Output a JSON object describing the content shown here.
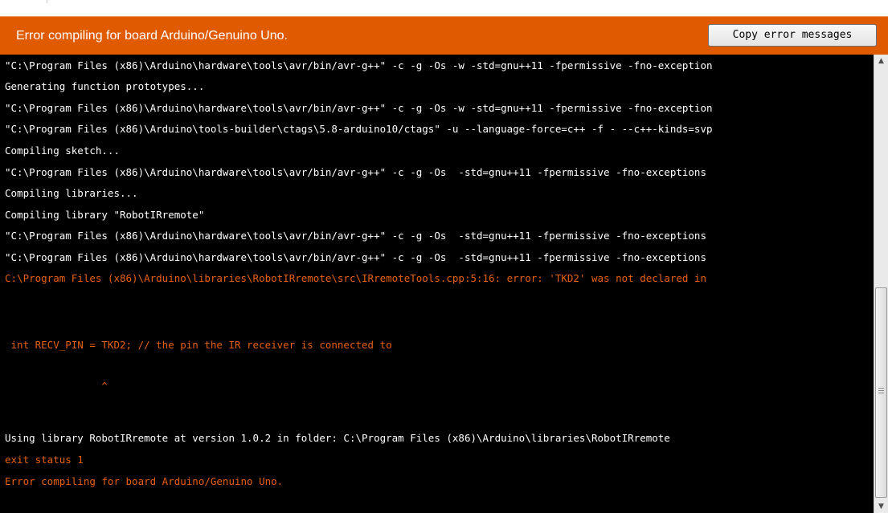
{
  "error_bar": {
    "message": "Error compiling for board Arduino/Genuino Uno.",
    "copy_button_label": "Copy error messages",
    "color": "#e05a00"
  },
  "console": {
    "lines": [
      {
        "text": "\"C:\\Program Files (x86)\\Arduino\\hardware\\tools\\avr/bin/avr-g++\" -c -g -Os -w -std=gnu++11 -fpermissive -fno-exception",
        "kind": "normal"
      },
      {
        "text": "Generating function prototypes...",
        "kind": "normal"
      },
      {
        "text": "\"C:\\Program Files (x86)\\Arduino\\hardware\\tools\\avr/bin/avr-g++\" -c -g -Os -w -std=gnu++11 -fpermissive -fno-exception",
        "kind": "normal"
      },
      {
        "text": "\"C:\\Program Files (x86)\\Arduino\\tools-builder\\ctags\\5.8-arduino10/ctags\" -u --language-force=c++ -f - --c++-kinds=svp",
        "kind": "normal"
      },
      {
        "text": "Compiling sketch...",
        "kind": "normal"
      },
      {
        "text": "\"C:\\Program Files (x86)\\Arduino\\hardware\\tools\\avr/bin/avr-g++\" -c -g -Os  -std=gnu++11 -fpermissive -fno-exceptions",
        "kind": "normal"
      },
      {
        "text": "Compiling libraries...",
        "kind": "normal"
      },
      {
        "text": "Compiling library \"RobotIRremote\"",
        "kind": "normal"
      },
      {
        "text": "\"C:\\Program Files (x86)\\Arduino\\hardware\\tools\\avr/bin/avr-g++\" -c -g -Os  -std=gnu++11 -fpermissive -fno-exceptions",
        "kind": "normal"
      },
      {
        "text": "\"C:\\Program Files (x86)\\Arduino\\hardware\\tools\\avr/bin/avr-g++\" -c -g -Os  -std=gnu++11 -fpermissive -fno-exceptions",
        "kind": "normal"
      },
      {
        "text": "C:\\Program Files (x86)\\Arduino\\libraries\\RobotIRremote\\src\\IRremoteTools.cpp:5:16: error: 'TKD2' was not declared in",
        "kind": "error"
      },
      {
        "text": " int RECV_PIN = TKD2; // the pin the IR receiver is connected to",
        "kind": "error"
      },
      {
        "text": "                ^",
        "kind": "error"
      },
      {
        "text": "Using library RobotIRremote at version 1.0.2 in folder: C:\\Program Files (x86)\\Arduino\\libraries\\RobotIRremote",
        "kind": "normal"
      },
      {
        "text": "exit status 1",
        "kind": "error"
      },
      {
        "text": "Error compiling for board Arduino/Genuino Uno.",
        "kind": "error"
      }
    ],
    "text_color": "#ffffff",
    "error_color": "#e66010"
  },
  "scrollbar": {
    "up_icon": "triangle-up",
    "down_icon": "triangle-down"
  }
}
